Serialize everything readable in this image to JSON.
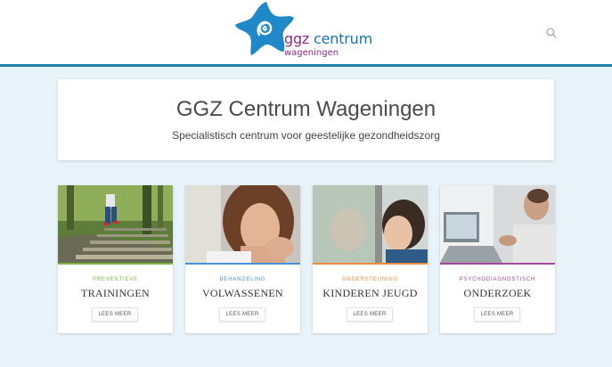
{
  "header": {
    "logo_word1": "ggz",
    "logo_word2": "centrum",
    "logo_sub": "wageningen",
    "search_icon": "search-icon"
  },
  "hero": {
    "title": "GGZ Centrum Wageningen",
    "subtitle": "Specialistisch centrum voor geestelijke gezondheidszorg"
  },
  "cards": [
    {
      "category": "PREVENTIEVE",
      "title": "TRAININGEN",
      "button": "LEES MEER",
      "accent": "#7cb342"
    },
    {
      "category": "BEHANDELING",
      "title": "VOLWASSENEN",
      "button": "LEES MEER",
      "accent": "#4a90d9"
    },
    {
      "category": "ONDERSTEUNING",
      "title": "KINDEREN JEUGD",
      "button": "LEES MEER",
      "accent": "#f08a3c"
    },
    {
      "category": "PSYCHODIAGNOSTISCH",
      "title": "ONDERZOEK",
      "button": "LEES MEER",
      "accent": "#a34a9e"
    }
  ],
  "colors": {
    "brand_blue": "#1f7fa8",
    "brand_purple": "#8b2a86",
    "background": "#e8f2f9"
  }
}
